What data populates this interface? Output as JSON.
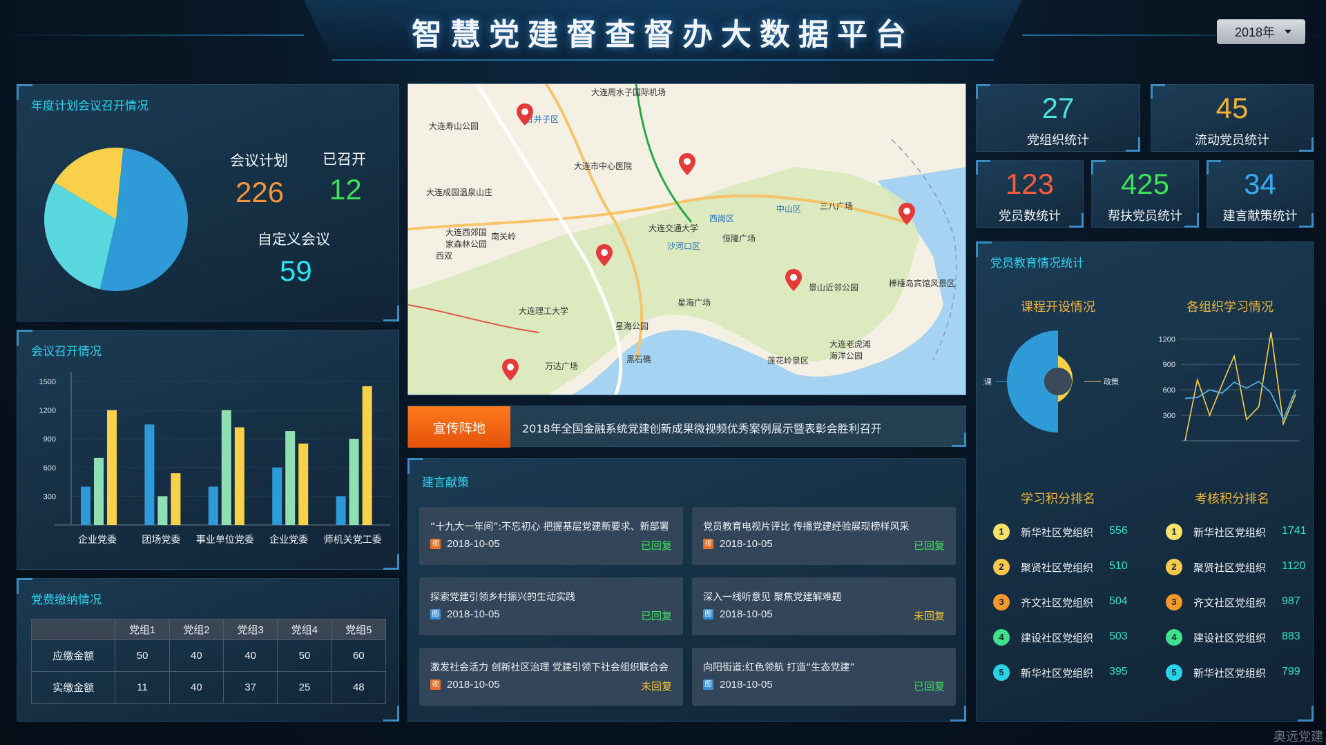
{
  "header": {
    "title": "智慧党建督查督办大数据平台",
    "year": "2018年"
  },
  "annual_plan": {
    "title": "年度计划会议召开情况",
    "plan_label": "会议计划",
    "plan_value": "226",
    "held_label": "已召开",
    "held_value": "12",
    "custom_label": "自定义会议",
    "custom_value": "59",
    "pie_colors": [
      "#2f9ad8",
      "#5ad8e0",
      "#f8d04a"
    ],
    "pie_values": [
      226,
      59,
      12
    ]
  },
  "meetings": {
    "title": "会议召开情况"
  },
  "fees": {
    "title": "党费缴纳情况",
    "columns": [
      "",
      "党组1",
      "党组2",
      "党组3",
      "党组4",
      "党组5"
    ],
    "rows": [
      {
        "label": "应缴金额",
        "values": [
          "50",
          "40",
          "40",
          "50",
          "60"
        ]
      },
      {
        "label": "实缴金额",
        "values": [
          "11",
          "40",
          "37",
          "25",
          "48"
        ]
      }
    ]
  },
  "map": {
    "labels": [
      "大连周水子国际机场",
      "大连寿山公园",
      "大连市中心医院",
      "大连成园温泉山庄",
      "大连西郊国家森林公园",
      "大连交通大学",
      "西岗区",
      "恒隆广场",
      "三八广场",
      "中山区",
      "沙河口区",
      "景山近邻公园",
      "棒棰岛宾馆风景区",
      "大连理工大学",
      "星海广场",
      "星海公园",
      "万达广场",
      "大连老虎滩海洋公园",
      "莲花岭景区",
      "黑石礁",
      "西双",
      "甘井子区",
      "南关岭"
    ]
  },
  "banner": {
    "tag": "宣传阵地",
    "text": "2018年全国金融系统党建创新成果微视频优秀案例展示暨表彰会胜利召开"
  },
  "suggestions": {
    "title": "建言献策",
    "items": [
      {
        "title": "“十九大一年间”:不忘初心 把握基层党建新要求、新部署",
        "icon": "视",
        "icon_color": "#e5702a",
        "date": "2018-10-05",
        "status": "已回复",
        "status_color": "#3fe05a"
      },
      {
        "title": "党员教育电视片评比 传播党建经验展现榜样风采",
        "icon": "视",
        "icon_color": "#e5702a",
        "date": "2018-10-05",
        "status": "已回复",
        "status_color": "#3fe05a"
      },
      {
        "title": "探索党建引领乡村振兴的生动实践",
        "icon": "图",
        "icon_color": "#3b8fd8",
        "date": "2018-10-05",
        "status": "已回复",
        "status_color": "#3fe05a"
      },
      {
        "title": "深入一线听意见 聚焦党建解难题",
        "icon": "图",
        "icon_color": "#3b8fd8",
        "date": "2018-10-05",
        "status": "未回复",
        "status_color": "#f5c431"
      },
      {
        "title": "激发社会活力 创新社区治理 党建引领下社会组织联合会",
        "icon": "视",
        "icon_color": "#e5702a",
        "date": "2018-10-05",
        "status": "未回复",
        "status_color": "#f5c431"
      },
      {
        "title": "向阳街道:红色领航 打造“生态党建”",
        "icon": "图",
        "icon_color": "#3b8fd8",
        "date": "2018-10-05",
        "status": "已回复",
        "status_color": "#3fe05a"
      }
    ]
  },
  "stats": [
    {
      "value": "27",
      "label": "党组织统计",
      "color": "#4be3e0"
    },
    {
      "value": "45",
      "label": "流动党员统计",
      "color": "#f0b43a"
    },
    {
      "value": "123",
      "label": "党员数统计",
      "color": "#ff5a3a"
    },
    {
      "value": "425",
      "label": "帮扶党员统计",
      "color": "#3ee05a"
    },
    {
      "value": "34",
      "label": "建言献策统计",
      "color": "#3aa8f0"
    }
  ],
  "education": {
    "title": "党员教育情况统计",
    "course_title": "课程开设情况",
    "study_title": "各组织学习情况",
    "study_rank_title": "学习积分排名",
    "exam_rank_title": "考核积分排名",
    "study_rank": [
      {
        "rank": "1",
        "name": "新华社区党组织",
        "score": "556",
        "color": "#f8e36a"
      },
      {
        "rank": "2",
        "name": "聚贤社区党组织",
        "score": "510",
        "color": "#f8c84a"
      },
      {
        "rank": "3",
        "name": "齐文社区党组织",
        "score": "504",
        "color": "#f59a2a"
      },
      {
        "rank": "4",
        "name": "建设社区党组织",
        "score": "503",
        "color": "#3ee08a"
      },
      {
        "rank": "5",
        "name": "新华社区党组织",
        "score": "395",
        "color": "#2ad2e8"
      }
    ],
    "exam_rank": [
      {
        "rank": "1",
        "name": "新华社区党组织",
        "score": "1741",
        "color": "#f8e36a"
      },
      {
        "rank": "2",
        "name": "聚贤社区党组织",
        "score": "1120",
        "color": "#f8c84a"
      },
      {
        "rank": "3",
        "name": "齐文社区党组织",
        "score": "987",
        "color": "#f59a2a"
      },
      {
        "rank": "4",
        "name": "建设社区党组织",
        "score": "883",
        "color": "#3ee08a"
      },
      {
        "rank": "5",
        "name": "新华社区党组织",
        "score": "799",
        "color": "#2ad2e8"
      }
    ]
  },
  "chart_data": [
    {
      "type": "bar",
      "categories": [
        "企业党委",
        "团场党委",
        "事业单位党委",
        "企业党委",
        "师机关党工委"
      ],
      "series": [
        {
          "values": [
            400,
            1050,
            400,
            600,
            300
          ],
          "color": "#2f9ad8"
        },
        {
          "values": [
            700,
            300,
            1200,
            980,
            900
          ],
          "color": "#8fe0b0"
        },
        {
          "values": [
            1200,
            540,
            1020,
            850,
            1450
          ],
          "color": "#f8d04a"
        }
      ],
      "yticks": [
        300,
        600,
        900,
        1200,
        1500
      ],
      "ylim": [
        0,
        1600
      ]
    },
    {
      "type": "pie",
      "labels": [
        "党课",
        "政策"
      ],
      "values": [
        50,
        50
      ],
      "colors": [
        "#2f9ad8",
        "#f8d04a"
      ]
    },
    {
      "type": "line",
      "x": [
        1,
        2,
        3,
        4,
        5,
        6,
        7,
        8,
        9,
        10,
        11
      ],
      "series": [
        {
          "values": [
            0,
            720,
            300,
            660,
            1000,
            250,
            400,
            1280,
            200,
            550
          ],
          "color": "#f8d04a"
        },
        {
          "values": [
            500,
            510,
            600,
            560,
            690,
            620,
            700,
            560,
            250,
            600
          ],
          "color": "#5ab8f0"
        }
      ],
      "yticks": [
        300,
        900,
        600,
        1200
      ],
      "ylim": [
        0,
        1300
      ]
    }
  ],
  "watermark": "奥远党建"
}
